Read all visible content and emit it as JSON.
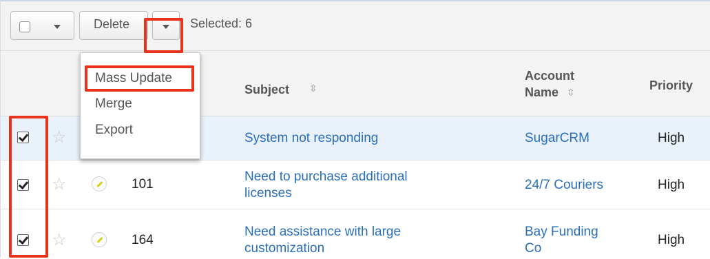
{
  "toolbar": {
    "delete_label": "Delete",
    "selected_text": "Selected: 6"
  },
  "dropdown_menu": {
    "items": [
      "Mass Update",
      "Merge",
      "Export"
    ]
  },
  "table": {
    "headers": {
      "subject": "Subject",
      "account_line1": "Account",
      "account_line2": "Name",
      "priority": "Priority"
    },
    "rows": [
      {
        "number": "",
        "subject": "System not responding",
        "account": "SugarCRM",
        "priority": "High",
        "checked": true
      },
      {
        "number": "101",
        "subject_line1": "Need to purchase additional",
        "subject_line2": "licenses",
        "account": "24/7 Couriers",
        "priority": "High",
        "checked": true
      },
      {
        "number": "164",
        "subject_line1": "Need assistance with large",
        "subject_line2": "customization",
        "account_line1": "Bay Funding",
        "account_line2": "Co",
        "priority": "High",
        "checked": true
      }
    ]
  },
  "icons": {
    "sort": "sort-arrows-icon",
    "star": "star-icon",
    "edit": "pencil-icon",
    "caret": "caret-down-icon"
  },
  "colors": {
    "highlight": "#e8321c",
    "link": "#2a6fb8",
    "row_selected": "#e9f2fb"
  }
}
